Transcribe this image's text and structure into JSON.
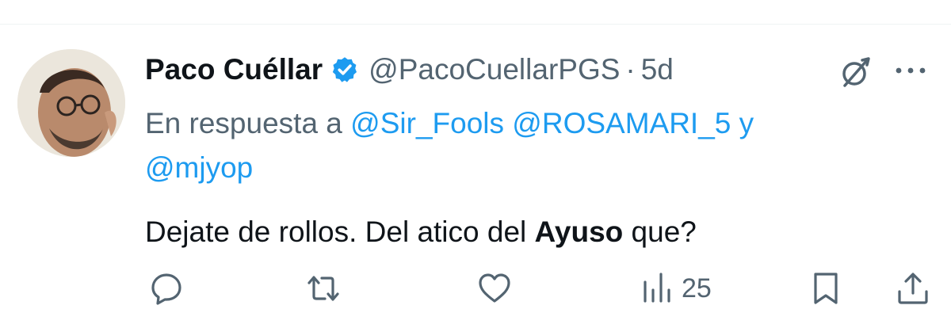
{
  "tweet": {
    "author_name": "Paco Cuéllar",
    "handle": "@PacoCuellarPGS",
    "separator": "·",
    "time": "5d",
    "reply_prefix": "En respuesta a",
    "reply_mentions": [
      "@Sir_Fools",
      "@ROSAMARI_5",
      "@mjyop"
    ],
    "reply_conjunction": "y",
    "text_before_bold": "Dejate de rollos. Del atico del ",
    "text_bold": "Ayuso",
    "text_after_bold": " que?",
    "views_count": "25"
  },
  "icons": {
    "verified": "verified-badge-icon",
    "grok": "grok-icon",
    "more": "more-icon",
    "reply": "reply-icon",
    "retweet": "retweet-icon",
    "like": "like-icon",
    "views": "views-icon",
    "bookmark": "bookmark-icon",
    "share": "share-icon"
  },
  "colors": {
    "text": "#0f1419",
    "secondary": "#536471",
    "accent": "#1d9bf0"
  }
}
